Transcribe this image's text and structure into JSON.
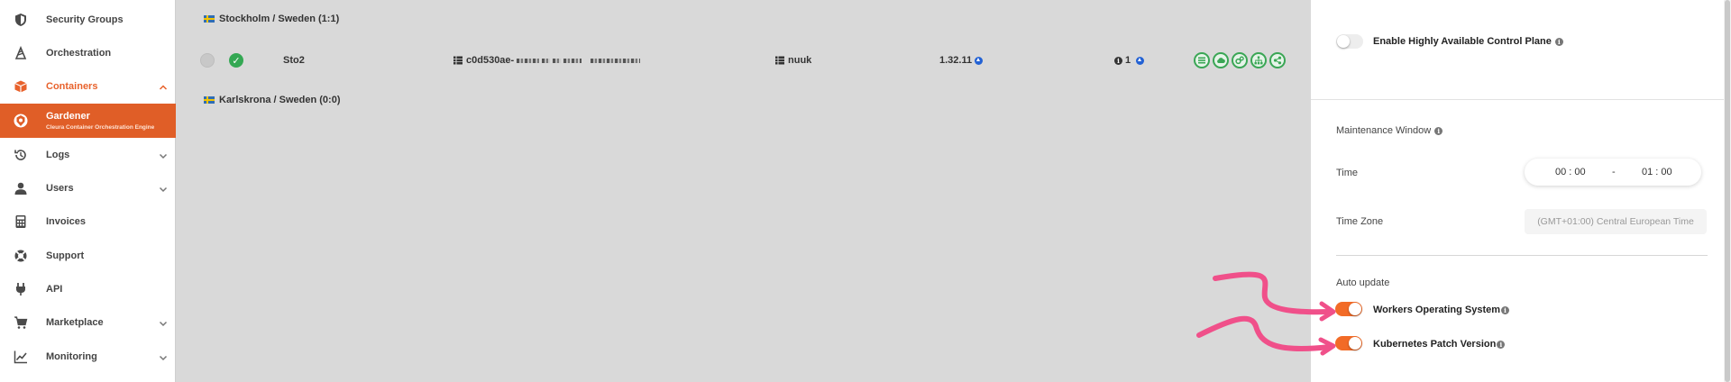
{
  "sidebar": {
    "items": [
      {
        "label": "Security Groups",
        "icon": "shield-icon"
      },
      {
        "label": "Orchestration",
        "icon": "orchestration-icon"
      },
      {
        "label": "Containers",
        "icon": "box-icon",
        "expanded": true
      },
      {
        "label": "Gardener",
        "sublabel": "Cleura Container Orchestration Engine",
        "icon": "gardener-icon",
        "selected": true
      },
      {
        "label": "Logs",
        "icon": "history-icon"
      },
      {
        "label": "Users",
        "icon": "user-icon"
      },
      {
        "label": "Invoices",
        "icon": "calculator-icon"
      },
      {
        "label": "Support",
        "icon": "lifebuoy-icon"
      },
      {
        "label": "API",
        "icon": "plug-icon"
      },
      {
        "label": "Marketplace",
        "icon": "cart-icon"
      },
      {
        "label": "Monitoring",
        "icon": "chart-line-icon"
      }
    ]
  },
  "main": {
    "regions": [
      {
        "name": "Stockholm / Sweden (1:1)"
      },
      {
        "name": "Karlskrona / Sweden (0:0)"
      }
    ],
    "cluster": {
      "name": "Sto2",
      "id_prefix": "c0d530ae-",
      "project": "nuuk",
      "version": "1.32.11",
      "notifications": "1"
    }
  },
  "panel": {
    "ha_label": "Enable Highly Available Control Plane",
    "ha_enabled": false,
    "maintenance_title": "Maintenance Window",
    "time_label": "Time",
    "time_start": "00 : 00",
    "time_separator": "-",
    "time_end": "01 : 00",
    "timezone_label": "Time Zone",
    "timezone_value": "(GMT+01:00) Central European Time",
    "auto_update_title": "Auto update",
    "workers_os_label": "Workers Operating System",
    "workers_os_enabled": true,
    "k8s_patch_label": "Kubernetes Patch Version",
    "k8s_patch_enabled": true
  },
  "colors": {
    "accent": "#e05e27",
    "toggle_on": "#f26b27",
    "success": "#34a853",
    "annotation_arrow": "#f0508a"
  }
}
